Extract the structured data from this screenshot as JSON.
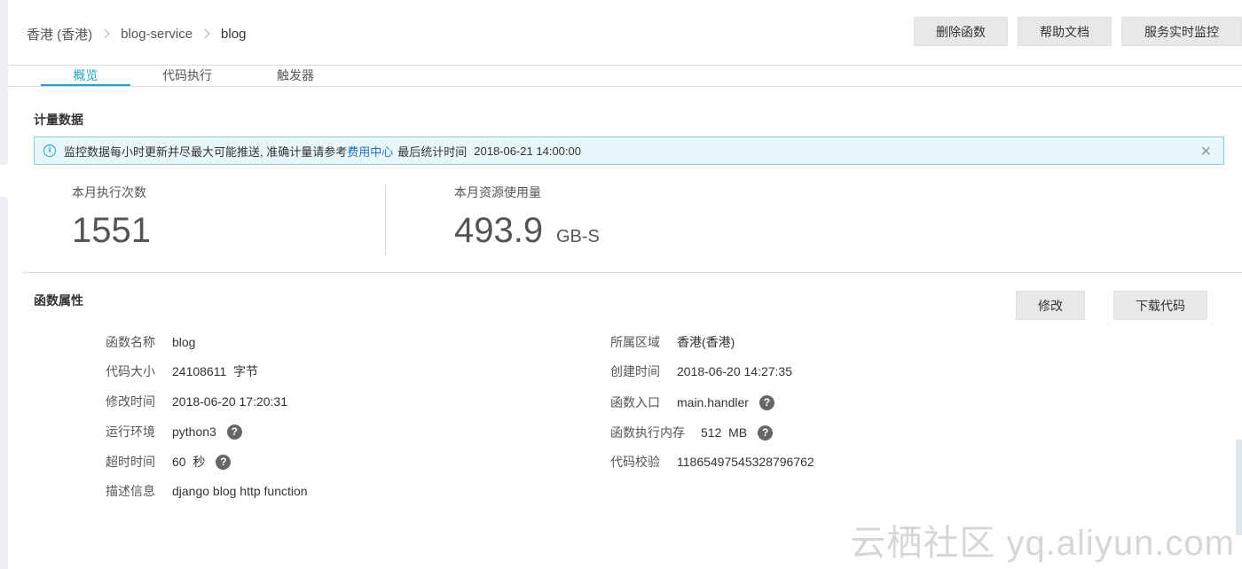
{
  "breadcrumb": [
    "香港 (香港)",
    "blog-service",
    "blog"
  ],
  "header_actions": {
    "delete": "删除函数",
    "help": "帮助文档",
    "monitor": "服务实时监控"
  },
  "tabs": [
    "概览",
    "代码执行",
    "触发器"
  ],
  "metering": {
    "title": "计量数据",
    "notice": {
      "icon": "info-icon",
      "text_before": "监控数据每小时更新并尽最大可能推送, 准确计量请参考",
      "link": "费用中心",
      "text_after": "最后统计时间",
      "time": "2018-06-21 14:00:00"
    },
    "invocations": {
      "label": "本月执行次数",
      "value": "1551"
    },
    "resource_usage": {
      "label": "本月资源使用量",
      "value": "493.9",
      "unit": "GB-S"
    }
  },
  "properties": {
    "title": "函数属性",
    "edit_label": "修改",
    "download_label": "下载代码",
    "left": [
      {
        "label": "函数名称",
        "value": "blog"
      },
      {
        "label": "代码大小",
        "value": "24108611  字节"
      },
      {
        "label": "修改时间",
        "value": "2018-06-20 17:20:31"
      },
      {
        "label": "运行环境",
        "value": "python3",
        "help": true
      },
      {
        "label": "超时时间",
        "value": "60  秒",
        "help": true
      },
      {
        "label": "描述信息",
        "value": "django blog http function"
      }
    ],
    "right": [
      {
        "label": "所属区域",
        "value": "香港(香港)"
      },
      {
        "label": "创建时间",
        "value": "2018-06-20 14:27:35"
      },
      {
        "label": "函数入口",
        "value": "main.handler",
        "help": true
      },
      {
        "label": "函数执行内存",
        "value": "512  MB",
        "help": true
      },
      {
        "label": "代码校验",
        "value": "11865497545328796762"
      }
    ]
  },
  "watermark": "云栖社区 yq.aliyun.com"
}
